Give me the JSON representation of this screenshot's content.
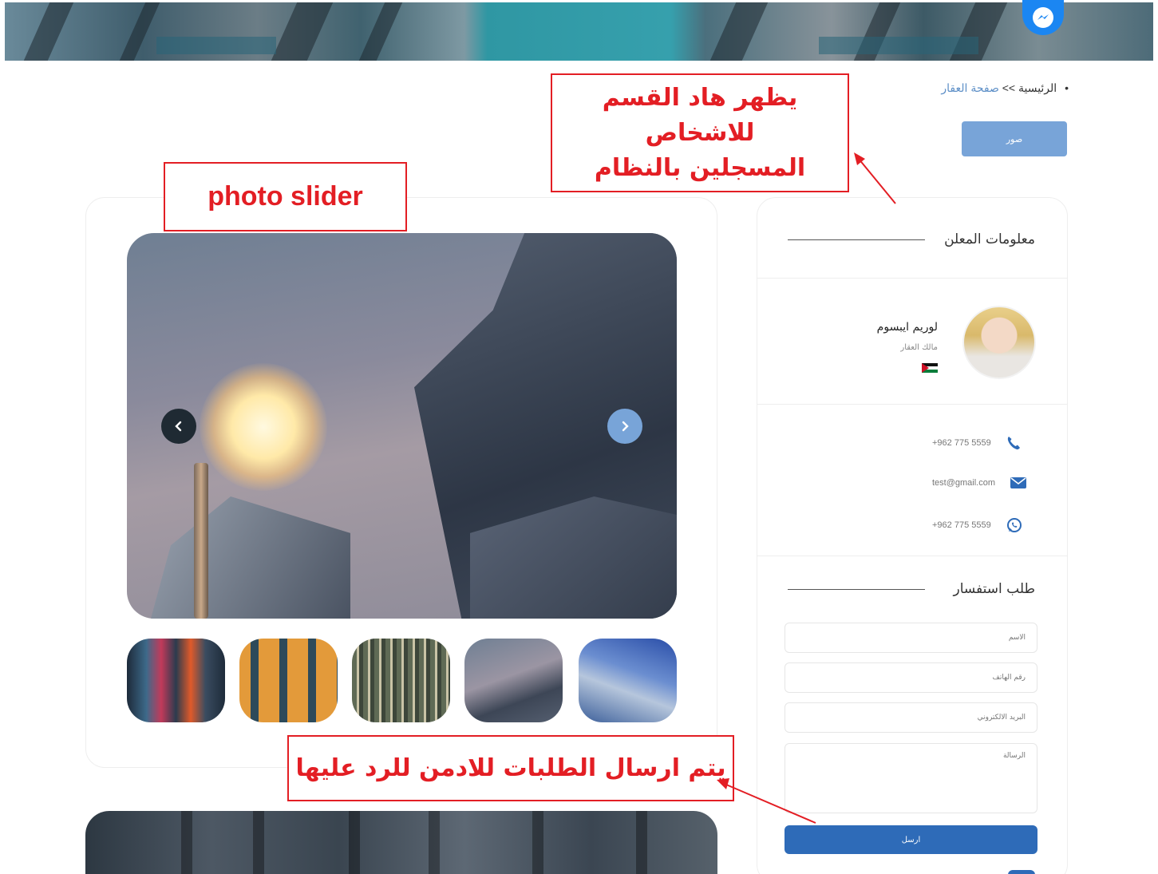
{
  "breadcrumb": {
    "home": "الرئيسية",
    "separator": ">>",
    "current": "صفحة العقار"
  },
  "photos_button": "صور",
  "annotations": {
    "top_note_line1": "يظهر هاد القسم للاشخاص",
    "top_note_line2": "المسجلين  بالنظام",
    "slider_note": "photo slider",
    "bottom_note": "يتم ارسال الطلبات للادمن للرد عليها",
    "color": "#e31e24"
  },
  "advertiser": {
    "title": "معلومات المعلن",
    "name": "لوريم ايبسوم",
    "role": "مالك العقار"
  },
  "contacts": {
    "phone": "+962 775 5559",
    "email": "test@gmail.com",
    "whatsapp": "+962 775 5559"
  },
  "inquiry": {
    "title": "طلب استفسار",
    "name_placeholder": "الاسم",
    "phone_placeholder": "رقم الهاتف",
    "email_placeholder": "البريد الالكتروني",
    "message_placeholder": "الرسالة",
    "send_label": "ارسل"
  },
  "colors": {
    "accent": "#78a4d8",
    "primary_button": "#2e6bb8",
    "messenger": "#1b86f2"
  },
  "icons": [
    "messenger-icon",
    "chevron-left-icon",
    "chevron-right-icon",
    "phone-icon",
    "envelope-icon",
    "whatsapp-icon",
    "jordan-flag-icon"
  ]
}
